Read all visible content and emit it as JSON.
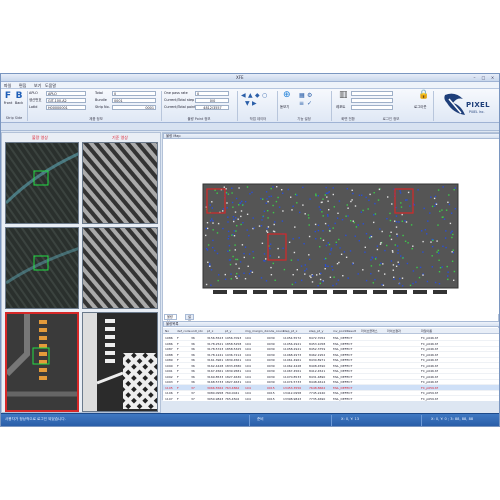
{
  "window": {
    "title": "XFE"
  },
  "menu": [
    "파일",
    "편집",
    "보기",
    "도움말"
  ],
  "ribbon": {
    "buttons": {
      "front": "Front",
      "back": "Back"
    },
    "strip_side_label": "Strip Side",
    "fields_a": [
      {
        "label": "APLO",
        "value": "APLO"
      },
      {
        "label": "생산번호",
        "value": "GIT-100-A2"
      },
      {
        "label": "LotId",
        "value": "H00000001"
      }
    ],
    "fields_b": [
      {
        "label": "Total",
        "value": "0"
      },
      {
        "label": "Bundle",
        "value": "0001"
      },
      {
        "label": "Strip No.",
        "value": "0001"
      }
    ],
    "fields_c": [
      {
        "label": "One pass rate",
        "value": "0"
      },
      {
        "label": "Current/Total step",
        "value": "0/0"
      },
      {
        "label": "Current/Total points",
        "value": "4812/3557"
      }
    ],
    "group_labels": [
      "제품 정보",
      "불량 Point 정보",
      "작업 데이터",
      "기능 설정",
      "화면 전환",
      "로그인 정보"
    ],
    "tools": {
      "label1": "돋보기",
      "label2": "기능",
      "label3": "레포트",
      "label4": "로그아웃"
    },
    "logo": {
      "text": "PIXEL",
      "sub": "PIXEL Inc."
    }
  },
  "left": {
    "col_defect": "불량 영상",
    "col_ref": "기준 영상"
  },
  "map_header": "불량 Map",
  "map_tabs": [
    "불량 Map",
    "설정"
  ],
  "table_header": "불량목록",
  "table": {
    "columns": [
      "No",
      "def_code",
      "unit_idx",
      "pt_x",
      "pt_y",
      "img_margin_dc",
      "code_count",
      "step_pt_x",
      "step_pt_y",
      "inv_pointResult",
      "라이브클래스",
      "라이브결과",
      "파일이름"
    ],
    "rows": [
      [
        "1086",
        "F",
        "36",
        "3156.5523",
        "1956.7093",
        "104",
        "0039",
        "11054.5572",
        "8472.7052",
        "FAIL_DEFECT",
        "",
        "",
        "FC_p046.tif"
      ],
      [
        "1086",
        "F",
        "36",
        "3178.2521",
        "1858.5258",
        "104",
        "0039",
        "11056.2921",
        "8453.1058",
        "FAIL_DEFECT",
        "",
        "",
        "FC_p046.tif"
      ],
      [
        "1087",
        "F",
        "36",
        "3178.5723",
        "1858.5325",
        "104",
        "0039",
        "11058.2921",
        "8452.3759",
        "FAIL_DEFECT",
        "",
        "",
        "FC_p046.tif"
      ],
      [
        "1088",
        "F",
        "36",
        "3178.1241",
        "1936.7212",
        "104",
        "0039",
        "11068.2973",
        "8462.1952",
        "FAIL_DEFECT",
        "",
        "",
        "FC_p046.tif"
      ],
      [
        "1089",
        "F",
        "36",
        "3161.3961",
        "1839.4561",
        "104",
        "0039",
        "11061.4961",
        "8430.8971",
        "FAIL_DEFECT",
        "",
        "",
        "FC_p046.tif"
      ],
      [
        "1090",
        "F",
        "36",
        "3162.4428",
        "1833.4580",
        "104",
        "0039",
        "11062.4428",
        "8408.4590",
        "FAIL_DEFECT",
        "",
        "",
        "FC_p046.tif"
      ],
      [
        "1091",
        "F",
        "36",
        "3167.4561",
        "1839.9581",
        "104",
        "0039",
        "11067.4561",
        "8412.4521",
        "FAIL_DEFECT",
        "",
        "",
        "FC_p046.tif"
      ],
      [
        "1092",
        "F",
        "36",
        "3169.8533",
        "1827.4630",
        "104",
        "0039",
        "11070.8533",
        "8431.4890",
        "FAIL_DEFECT",
        "",
        "",
        "FC_p046.tif"
      ],
      [
        "1093",
        "F",
        "36",
        "3168.5733",
        "1827.4631",
        "104",
        "0039",
        "11074.5733",
        "8448.4614",
        "FAIL_DEFECT",
        "",
        "",
        "FC_p046.tif"
      ],
      [
        "1105",
        "F",
        "37",
        "3066.5562",
        "763.4862",
        "104",
        "0015",
        "13453.3550",
        "7648.8662",
        "FAIL_DEFECT",
        "",
        "",
        "FC_p059.tif"
      ],
      [
        "1106",
        "F",
        "37",
        "3080.0958",
        "760.0041",
        "104",
        "0015",
        "13412.0958",
        "7745.2240",
        "FAIL_DEFECT",
        "",
        "",
        "FC_p059.tif"
      ],
      [
        "1107",
        "F",
        "37",
        "3050.9843",
        "765.4502",
        "104",
        "0015",
        "13398.9843",
        "7735.4690",
        "FAIL_DEFECT",
        "",
        "",
        "FC_p059.tif"
      ]
    ]
  },
  "status": {
    "message": "사용자가 정상적으로 로그인 되었습니다.",
    "state": "준비",
    "pos1": "X: 0, Y: 13",
    "pos2": "X: 0, Y: 0 ; 3: 88, 88, 88"
  },
  "colors": {
    "accent": "#2a5ea8",
    "defect_frame": "#d62828",
    "roi_box": "#22dd44"
  }
}
